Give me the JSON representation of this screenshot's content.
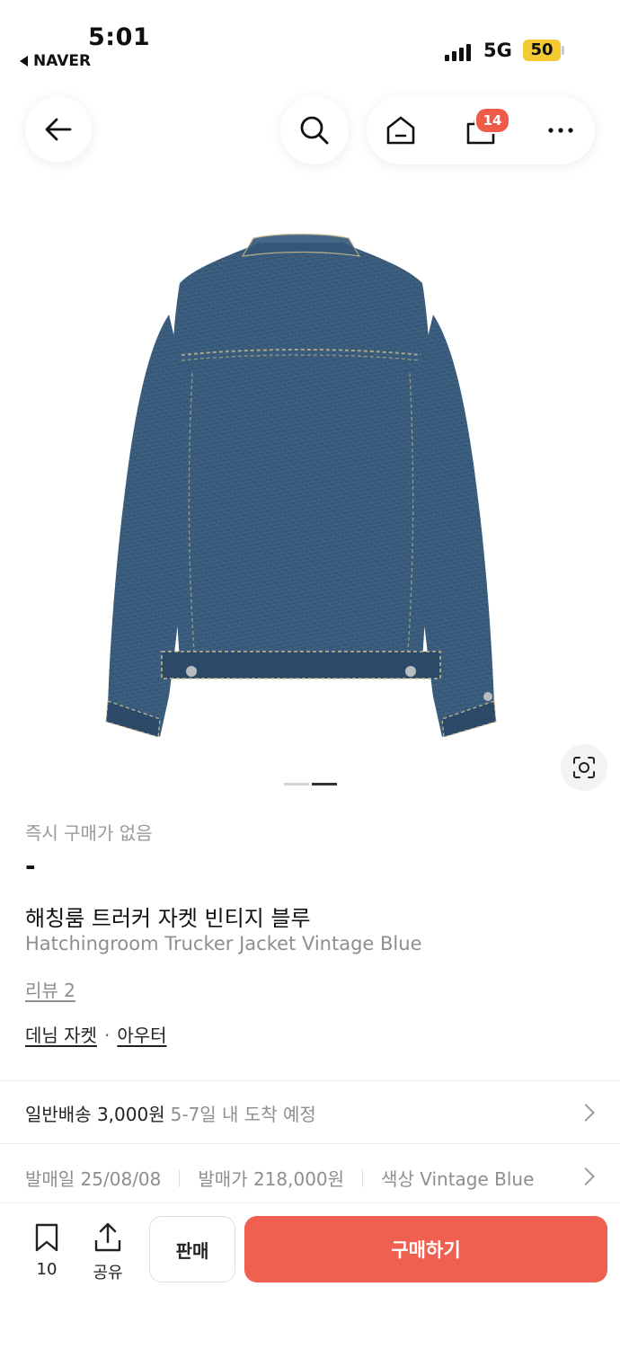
{
  "status_bar": {
    "time": "5:01",
    "back_app": "NAVER",
    "network": "5G",
    "battery": "50"
  },
  "nav": {
    "cart_count": "14",
    "icons": [
      "back-arrow-icon",
      "search-icon",
      "home-icon",
      "shopping-bag-icon",
      "more-icon"
    ]
  },
  "product": {
    "instant_buy": "즉시 구매가 없음",
    "price": "-",
    "name_ko": "해칭룸 트러커 자켓 빈티지 블루",
    "name_en": "Hatchingroom Trucker Jacket Vintage Blue",
    "review": "리뷰 2",
    "category_1": "데님 자켓",
    "category_sep": "·",
    "category_2": "아우터",
    "image_pages": 2,
    "active_page": 2
  },
  "shipping": {
    "label": "일반배송 3,000원",
    "eta": "5-7일 내 도착 예정"
  },
  "meta": {
    "release_date": "발매일 25/08/08",
    "release_price": "발매가 218,000원",
    "color": "색상 Vintage Blue"
  },
  "bottom_bar": {
    "bookmark_count": "10",
    "share_label": "공유",
    "sell_label": "판매",
    "buy_label": "구매하기"
  },
  "colors": {
    "accent": "#ef6050",
    "badge": "#ef5a49",
    "battery": "#f4c932",
    "denim": "#3a5a78"
  }
}
